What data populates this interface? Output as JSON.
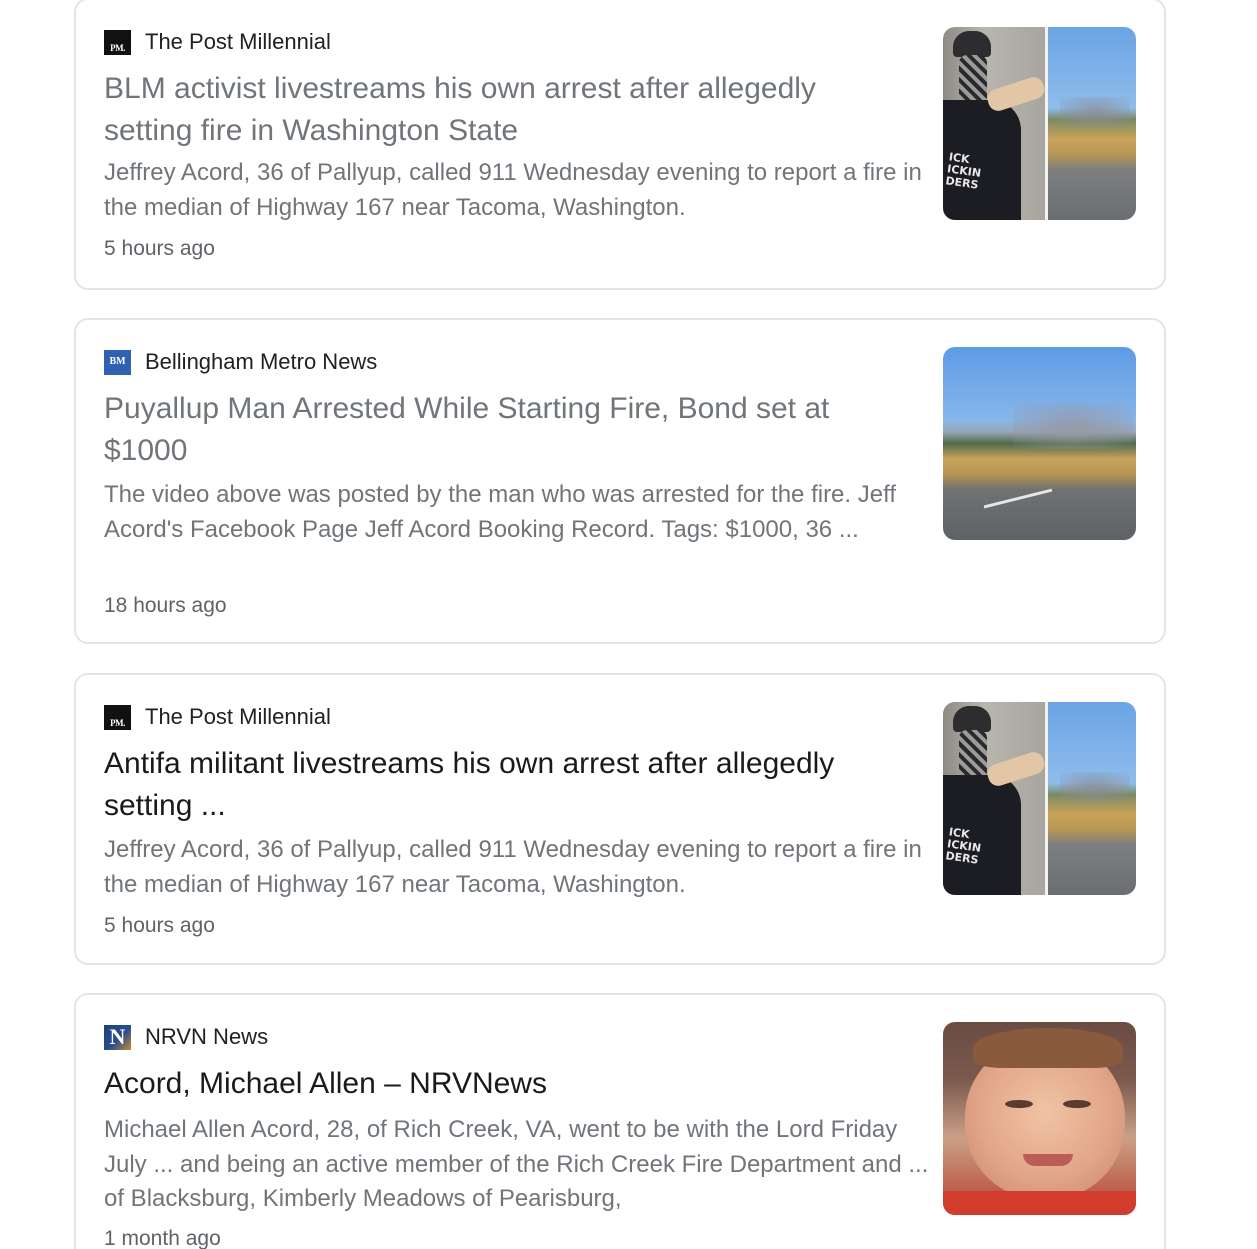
{
  "articles": [
    {
      "source": "The Post Millennial",
      "favicon_text": "PM.",
      "headline": "BLM activist livestreams his own arrest after allegedly setting fire in Washington State",
      "snippet": "Jeffrey Acord, 36 of Pallyup, called 911 Wednesday evening to report a fire in the median of Highway 167 near Tacoma, Washington.",
      "time": "5 hours ago",
      "thumb_text": "ICK ICKIN DERS"
    },
    {
      "source": "Bellingham Metro News",
      "favicon_text": "BM",
      "headline": "Puyallup Man Arrested While Starting Fire, Bond set at $1000",
      "snippet": "The video above was posted by the man who was arrested for the fire. Jeff Acord's Facebook Page Jeff Acord Booking Record. Tags: $1000, 36 ...",
      "time": "18 hours ago"
    },
    {
      "source": "The Post Millennial",
      "favicon_text": "PM.",
      "headline": "Antifa militant livestreams his own arrest after allegedly setting ...",
      "snippet": "Jeffrey Acord, 36 of Pallyup, called 911 Wednesday evening to report a fire in the median of Highway 167 near Tacoma, Washington.",
      "time": "5 hours ago",
      "thumb_text": "ICK ICKIN DERS"
    },
    {
      "source": "NRVN News",
      "favicon_text": "N",
      "headline": "Acord, Michael Allen – NRVNews",
      "snippet": "Michael Allen Acord, 28, of Rich Creek, VA, went to be with the Lord Friday July ... and being an active member of the Rich Creek Fire Department and ... of Blacksburg, Kimberly Meadows of Pearisburg,",
      "time": "1 month ago"
    }
  ]
}
